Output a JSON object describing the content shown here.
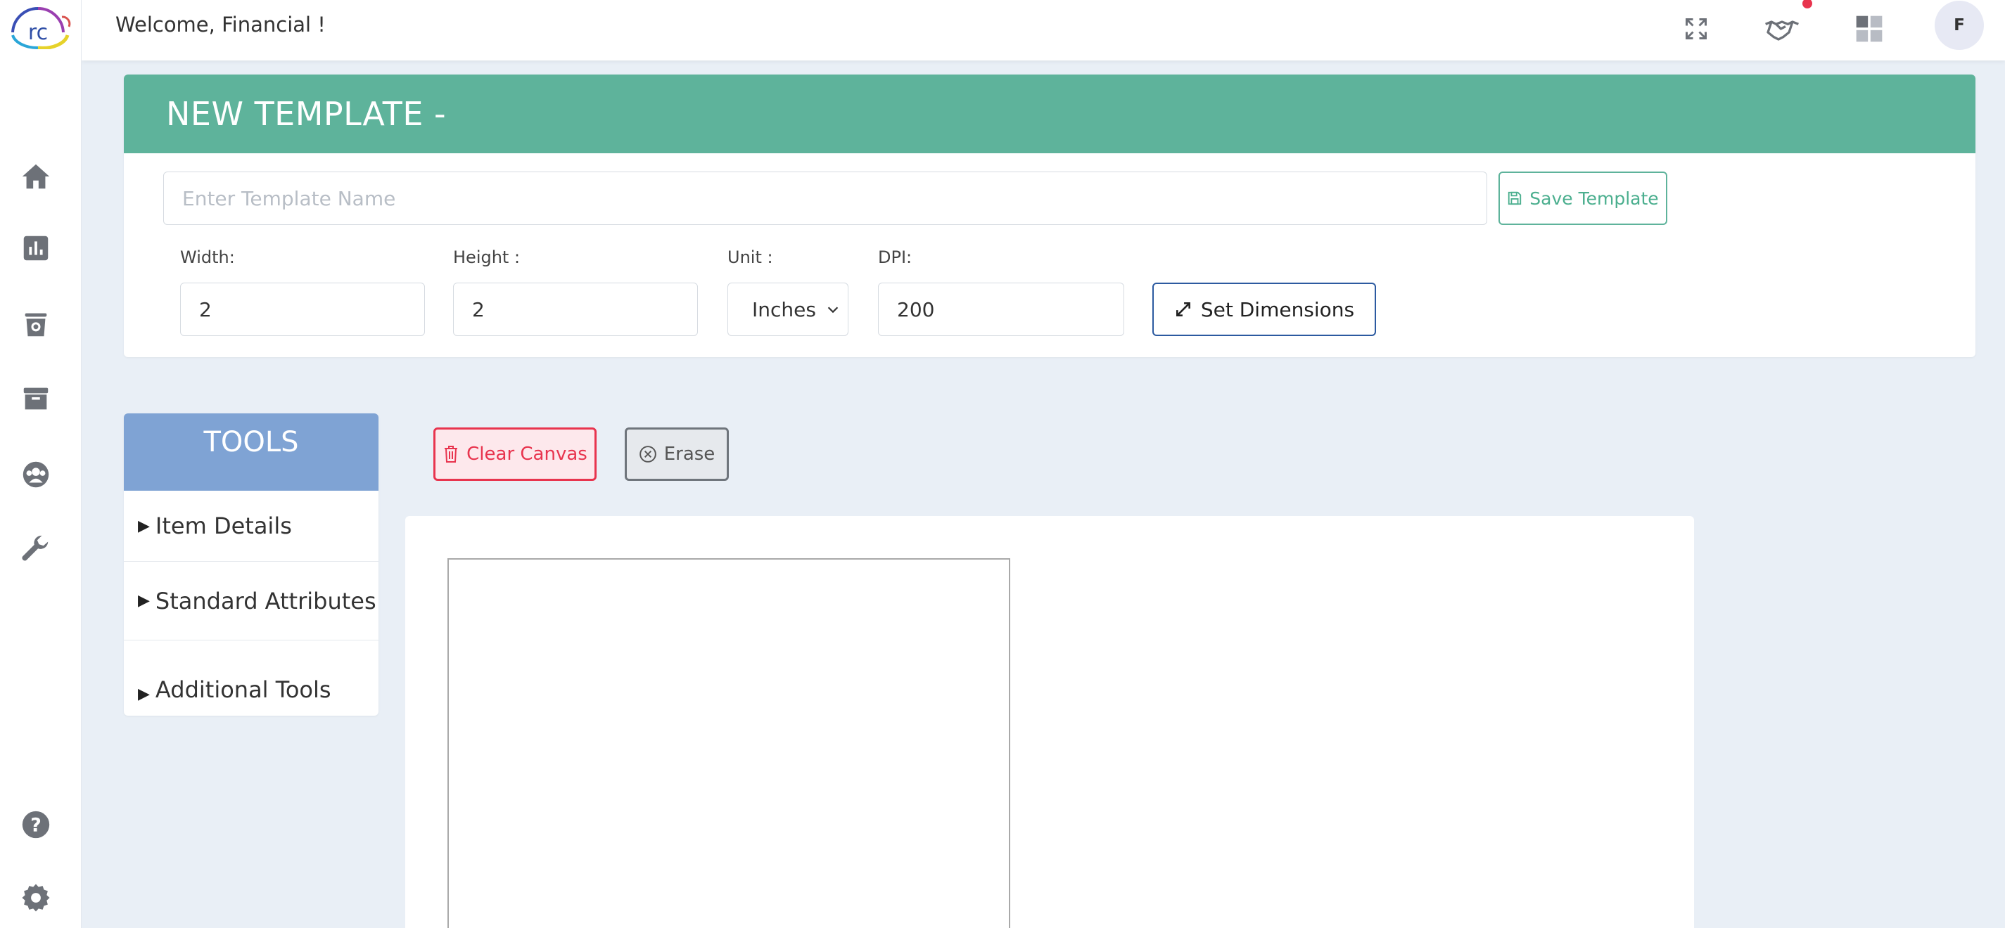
{
  "header": {
    "welcome": "Welcome, Financial !",
    "avatar_initial": "F",
    "notification_color": "#e8344e"
  },
  "logo": {
    "text": "rc"
  },
  "sidebar": {
    "items": [
      {
        "name": "home-icon"
      },
      {
        "name": "reports-icon"
      },
      {
        "name": "bin-icon"
      },
      {
        "name": "archive-icon"
      },
      {
        "name": "users-icon"
      },
      {
        "name": "wrench-icon"
      },
      {
        "name": "help-icon"
      },
      {
        "name": "settings-gear-icon"
      }
    ]
  },
  "template": {
    "title": "NEW TEMPLATE -",
    "name_placeholder": "Enter Template Name",
    "name_value": "",
    "save_label": "Save Template",
    "width_label": "Width:",
    "width_value": "2",
    "height_label": "Height :",
    "height_value": "2",
    "unit_label": "Unit :",
    "unit_value": "Inches",
    "dpi_label": "DPI:",
    "dpi_value": "200",
    "set_dimensions_label": "Set Dimensions",
    "accent_color": "#5eb39b"
  },
  "tools": {
    "title": "TOOLS",
    "items": [
      {
        "label": "Item Details"
      },
      {
        "label": "Standard Attributes"
      },
      {
        "label": "Additional Tools"
      }
    ],
    "header_color": "#7fa3d4"
  },
  "canvas_actions": {
    "clear_label": "Clear Canvas",
    "erase_label": "Erase"
  }
}
